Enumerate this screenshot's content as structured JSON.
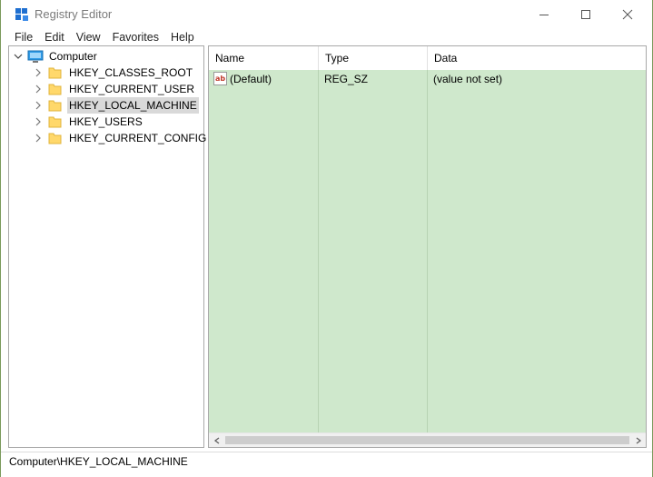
{
  "window": {
    "title": "Registry Editor"
  },
  "menu": [
    "File",
    "Edit",
    "View",
    "Favorites",
    "Help"
  ],
  "tree": {
    "root": "Computer",
    "items": [
      {
        "label": "HKEY_CLASSES_ROOT",
        "selected": false
      },
      {
        "label": "HKEY_CURRENT_USER",
        "selected": false
      },
      {
        "label": "HKEY_LOCAL_MACHINE",
        "selected": true
      },
      {
        "label": "HKEY_USERS",
        "selected": false
      },
      {
        "label": "HKEY_CURRENT_CONFIG",
        "selected": false
      }
    ]
  },
  "list": {
    "columns": [
      "Name",
      "Type",
      "Data"
    ],
    "rows": [
      {
        "icon": "string-value-icon",
        "name": "(Default)",
        "type": "REG_SZ",
        "data": "(value not set)"
      }
    ]
  },
  "statusbar": {
    "path": "Computer\\HKEY_LOCAL_MACHINE"
  },
  "colors": {
    "list_background": "#cfe8cc",
    "selection": "#d9d9d9",
    "app_icon": "#1f6fd0"
  },
  "icons": {
    "app": "registry-icon",
    "computer": "computer-icon",
    "folder": "folder-icon"
  }
}
